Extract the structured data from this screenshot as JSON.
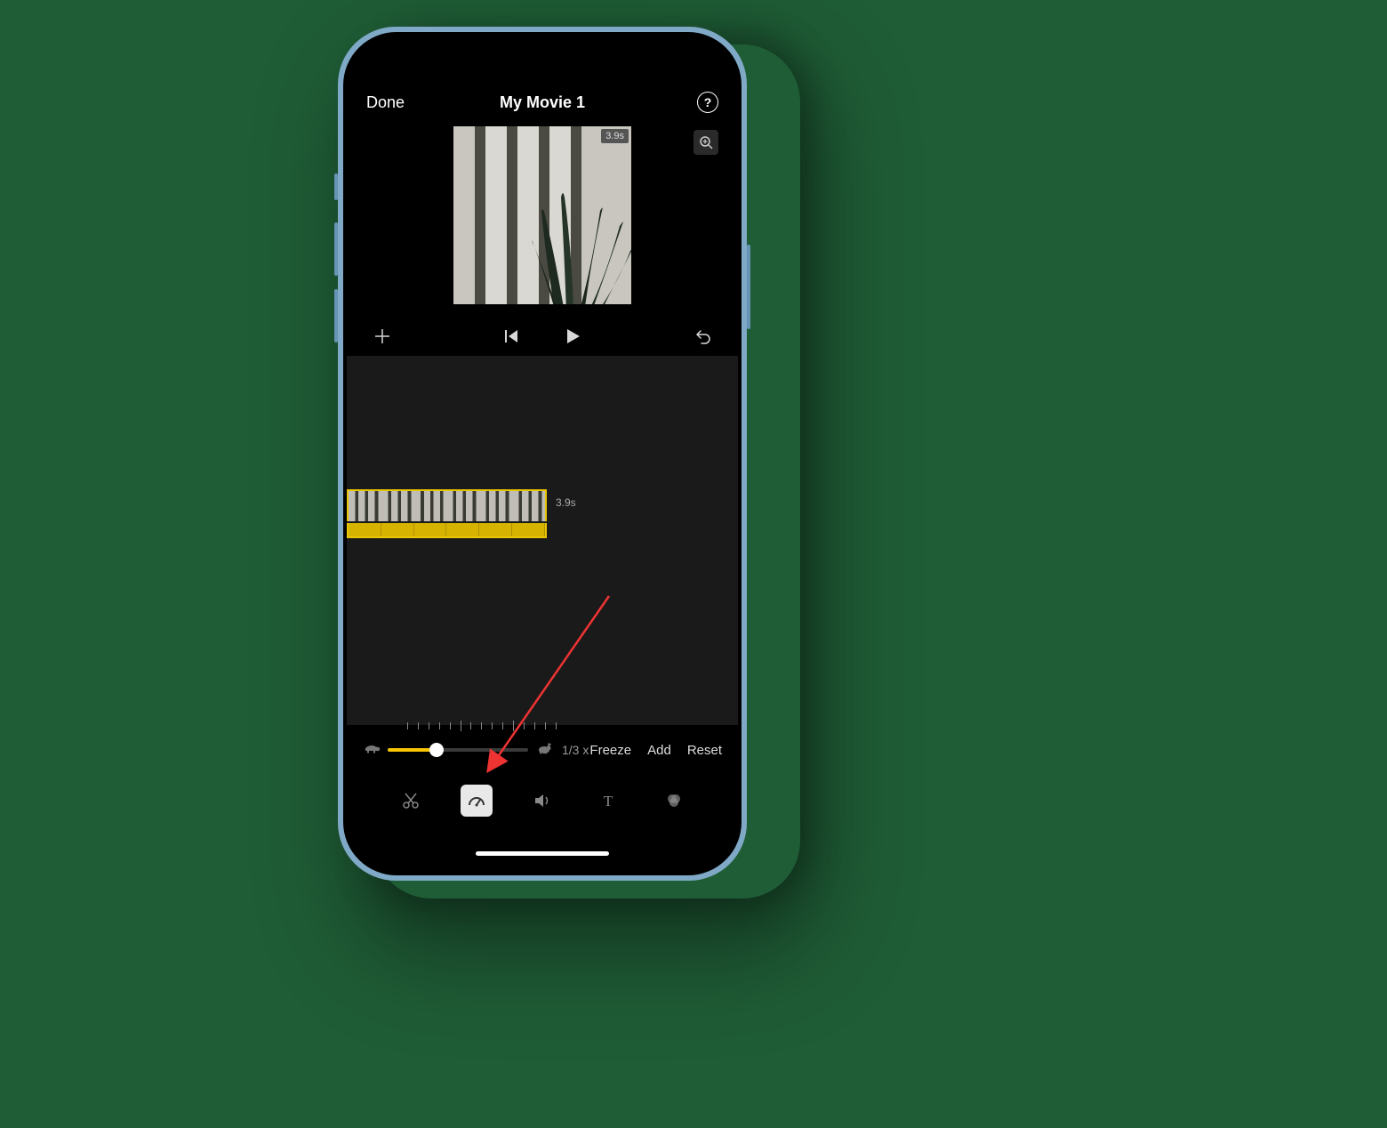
{
  "header": {
    "done": "Done",
    "title": "My Movie 1"
  },
  "preview": {
    "duration_badge": "3.9s"
  },
  "timeline": {
    "clip_duration": "3.9s"
  },
  "speed": {
    "multiplier": "1/3 x",
    "freeze": "Freeze",
    "add": "Add",
    "reset": "Reset"
  }
}
